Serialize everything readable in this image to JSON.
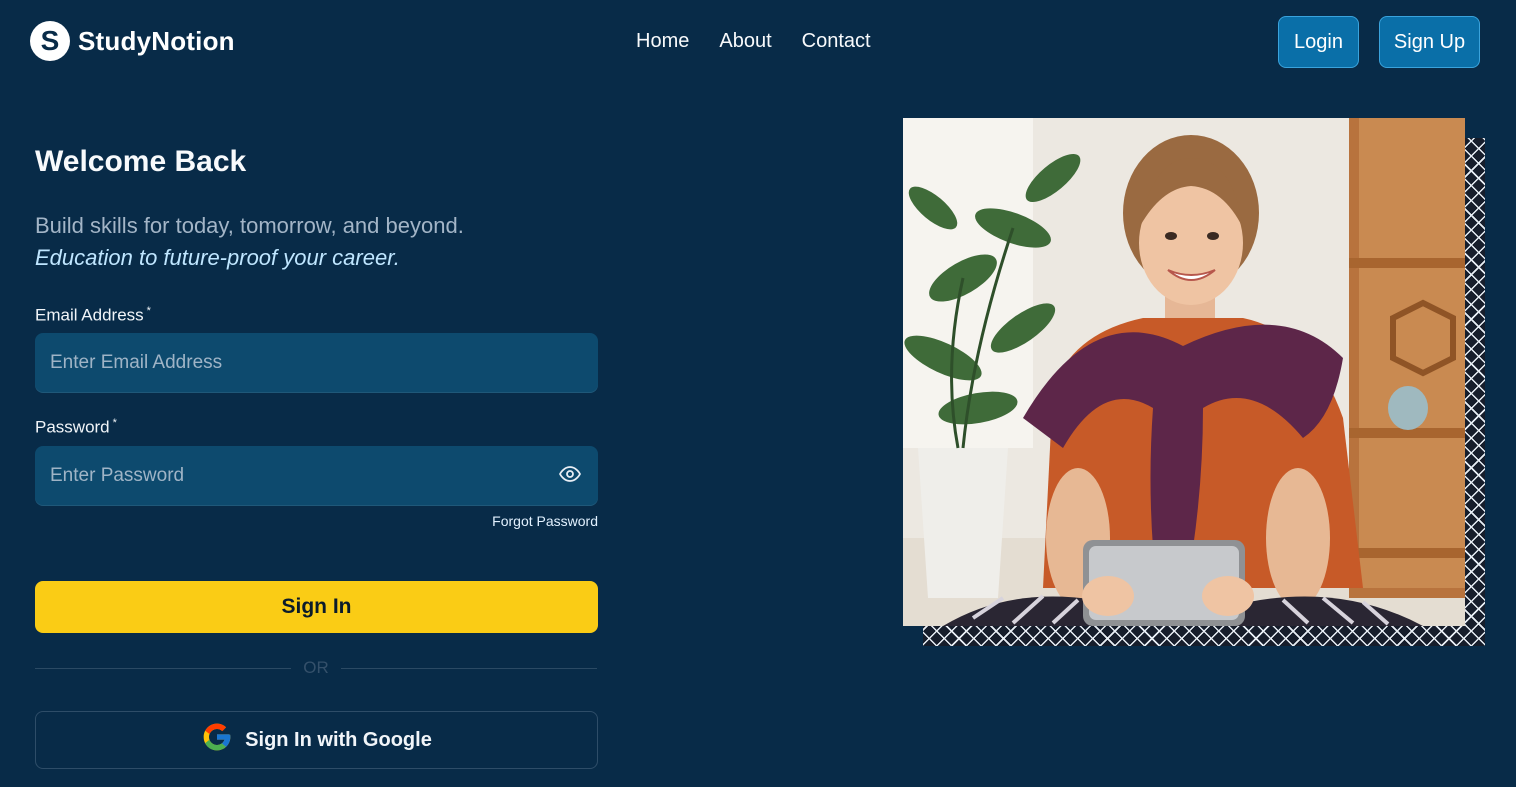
{
  "header": {
    "logo_letter": "S",
    "logo_text": "StudyNotion",
    "nav": [
      "Home",
      "About",
      "Contact"
    ],
    "login_label": "Login",
    "signup_label": "Sign Up"
  },
  "form": {
    "title": "Welcome Back",
    "subtitle_line1": "Build skills for today, tomorrow, and beyond.",
    "subtitle_line2": "Education to future-proof your career.",
    "email_label": "Email Address",
    "email_placeholder": "Enter Email Address",
    "email_value": "",
    "password_label": "Password",
    "password_placeholder": "Enter Password",
    "required_mark": "*",
    "forgot_label": "Forgot Password",
    "signin_label": "Sign In",
    "or_label": "OR",
    "google_label": "Sign In with Google"
  },
  "colors": {
    "background": "#082b48",
    "accent_yellow": "#facc15",
    "button_blue": "#0a6fa8",
    "input_bg": "#0d4a6e"
  },
  "icons": {
    "logo": "studynotion-logo-icon",
    "password_toggle": "eye-icon",
    "google": "google-icon"
  }
}
